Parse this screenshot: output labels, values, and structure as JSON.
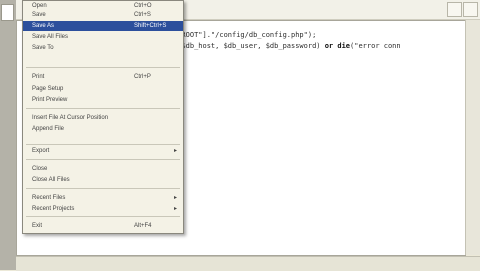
{
  "editor": {
    "code_line_1": "T_ROOT\"].\"/config/db_config.php\");",
    "code_line_2_a": "t($db_host, $db_user, $db_password) ",
    "code_line_2_or": "or",
    "code_line_2_die": "die",
    "code_line_2_b": "(\"error conn"
  },
  "file_menu": {
    "items": [
      {
        "label": "Open",
        "shortcut": "Ctrl+O"
      },
      {
        "label": "Save",
        "shortcut": "Ctrl+S"
      },
      {
        "label": "Save As",
        "shortcut": "Shift+Ctrl+S"
      },
      {
        "label": "Save All Files",
        "shortcut": ""
      },
      {
        "label": "Save To",
        "shortcut": ""
      },
      {
        "label": "Print",
        "shortcut": "Ctrl+P"
      },
      {
        "label": "Page Setup",
        "shortcut": ""
      },
      {
        "label": "Print Preview",
        "shortcut": ""
      },
      {
        "label": "Insert File At Cursor Position",
        "shortcut": ""
      },
      {
        "label": "Append File",
        "shortcut": ""
      },
      {
        "label": "Export",
        "shortcut": ""
      },
      {
        "label": "Close",
        "shortcut": ""
      },
      {
        "label": "Close All Files",
        "shortcut": ""
      },
      {
        "label": "Recent Files",
        "shortcut": ""
      },
      {
        "label": "Recent Projects",
        "shortcut": ""
      },
      {
        "label": "Exit",
        "shortcut": "Alt+F4"
      }
    ]
  },
  "colors": {
    "menu_highlight": "#2c4f9c",
    "menu_background": "#f4f2e6"
  }
}
